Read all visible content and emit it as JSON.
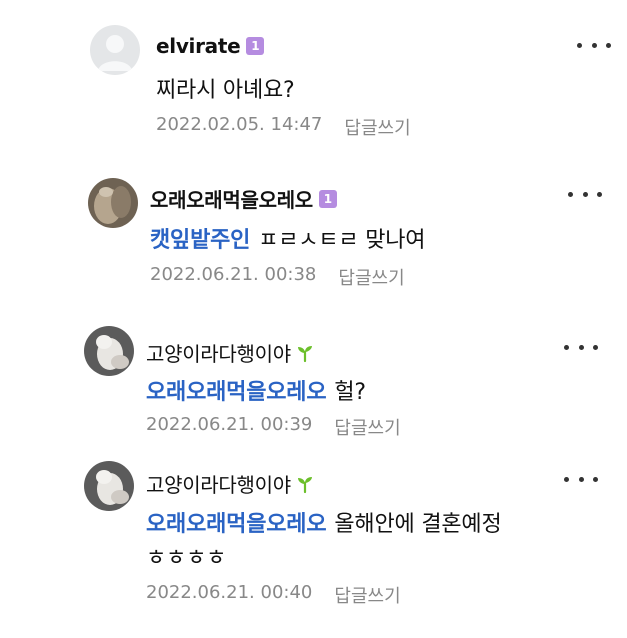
{
  "colors": {
    "mention": "#2a63c4",
    "meta_text": "#888888",
    "level_badge": "#b58ce0",
    "sprout": "#6cbf2b"
  },
  "comments": [
    {
      "nickname": "elvirate",
      "badge": "1",
      "body": "찌라시 아녜요?",
      "mention": "",
      "date": "2022.02.05. 14:47",
      "reply_label": "답글쓰기",
      "avatar": "default-profile-icon"
    },
    {
      "nickname": "오래오래먹을오레오",
      "badge": "1",
      "mention": "캣잎밭주인",
      "body": "ㅍㄹㅅㅌㄹ 맞나여",
      "date": "2022.06.21. 00:38",
      "reply_label": "답글쓰기",
      "avatar": "cat-photo"
    },
    {
      "nickname": "고양이라다행이야",
      "badge_icon": "sprout-icon",
      "mention": "오래오래먹을오레오",
      "body": "헐?",
      "date": "2022.06.21. 00:39",
      "reply_label": "답글쓰기",
      "avatar": "cat-photo"
    },
    {
      "nickname": "고양이라다행이야",
      "badge_icon": "sprout-icon",
      "mention": "오래오래먹을오레오",
      "body": "올해안에 결혼예정",
      "body_line2": "ㅎㅎㅎㅎ",
      "date": "2022.06.21. 00:40",
      "reply_label": "답글쓰기",
      "avatar": "cat-photo"
    }
  ]
}
